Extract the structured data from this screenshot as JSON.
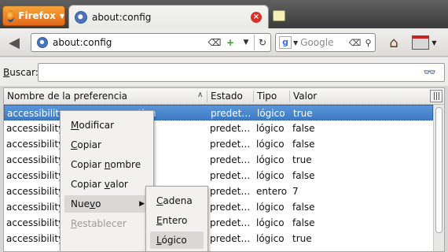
{
  "browser": {
    "menu_label": "Firefox",
    "tab_title": "about:config",
    "url": "about:config",
    "search_engine": "Google",
    "colors": {
      "menu_orange": "#e8781e",
      "selection_blue": "#4a86cf",
      "tab_close_red": "#d7322a"
    }
  },
  "icons": [
    "firefox-logo-icon",
    "close-tab-icon",
    "new-tab-icon",
    "back-arrow-icon",
    "page-favicon",
    "clear-url-icon",
    "bookmark-add-icon",
    "dropmarker-icon",
    "reload-icon",
    "google-icon",
    "search-magnifier-icon",
    "home-icon",
    "addon-toolbar-icon",
    "binoculars-icon",
    "column-picker-icon"
  ],
  "search": {
    "label_prefix": "",
    "label_accel": "B",
    "label_rest": "uscar:",
    "value": ""
  },
  "table": {
    "headers": [
      "Nombre de la preferencia",
      "Estado",
      "Tipo",
      "Valor"
    ],
    "rows": [
      {
        "name": "accessibility.…………………ation",
        "estado": "predet…",
        "tipo": "lógico",
        "valor": "true",
        "selected": true
      },
      {
        "name": "accessibility.",
        "estado": "predet…",
        "tipo": "lógico",
        "valor": "false"
      },
      {
        "name": "accessibility.",
        "estado": "predet…",
        "tipo": "lógico",
        "valor": "false"
      },
      {
        "name": "accessibility.                  tcut.ena…",
        "estado": "predet…",
        "tipo": "lógico",
        "valor": "true"
      },
      {
        "name": "accessibility.                  ontrol",
        "estado": "predet…",
        "tipo": "lógico",
        "valor": "false"
      },
      {
        "name": "accessibility.",
        "estado": "predet…",
        "tipo": "entero",
        "valor": "7"
      },
      {
        "name": "accessibility.",
        "estado": "predet…",
        "tipo": "lógico",
        "valor": "false"
      },
      {
        "name": "accessibility.",
        "estado": "predet…",
        "tipo": "lógico",
        "valor": "false"
      },
      {
        "name": "accessibility.typeaheadfind.autos…",
        "estado": "predet…",
        "tipo": "lógico",
        "valor": "true"
      }
    ]
  },
  "context_menu": {
    "items": [
      {
        "pre": "",
        "accel": "M",
        "post": "odificar"
      },
      {
        "pre": "",
        "accel": "C",
        "post": "opiar"
      },
      {
        "pre": "Copiar ",
        "accel": "n",
        "post": "ombre"
      },
      {
        "pre": "Copiar ",
        "accel": "v",
        "post": "alor"
      },
      {
        "pre": "Nue",
        "accel": "v",
        "post": "o"
      },
      {
        "pre": "",
        "accel": "R",
        "post": "establecer"
      }
    ],
    "submenu": [
      {
        "pre": "",
        "accel": "C",
        "post": "adena"
      },
      {
        "pre": "",
        "accel": "E",
        "post": "ntero"
      },
      {
        "pre": "",
        "accel": "L",
        "post": "ógico"
      }
    ]
  }
}
